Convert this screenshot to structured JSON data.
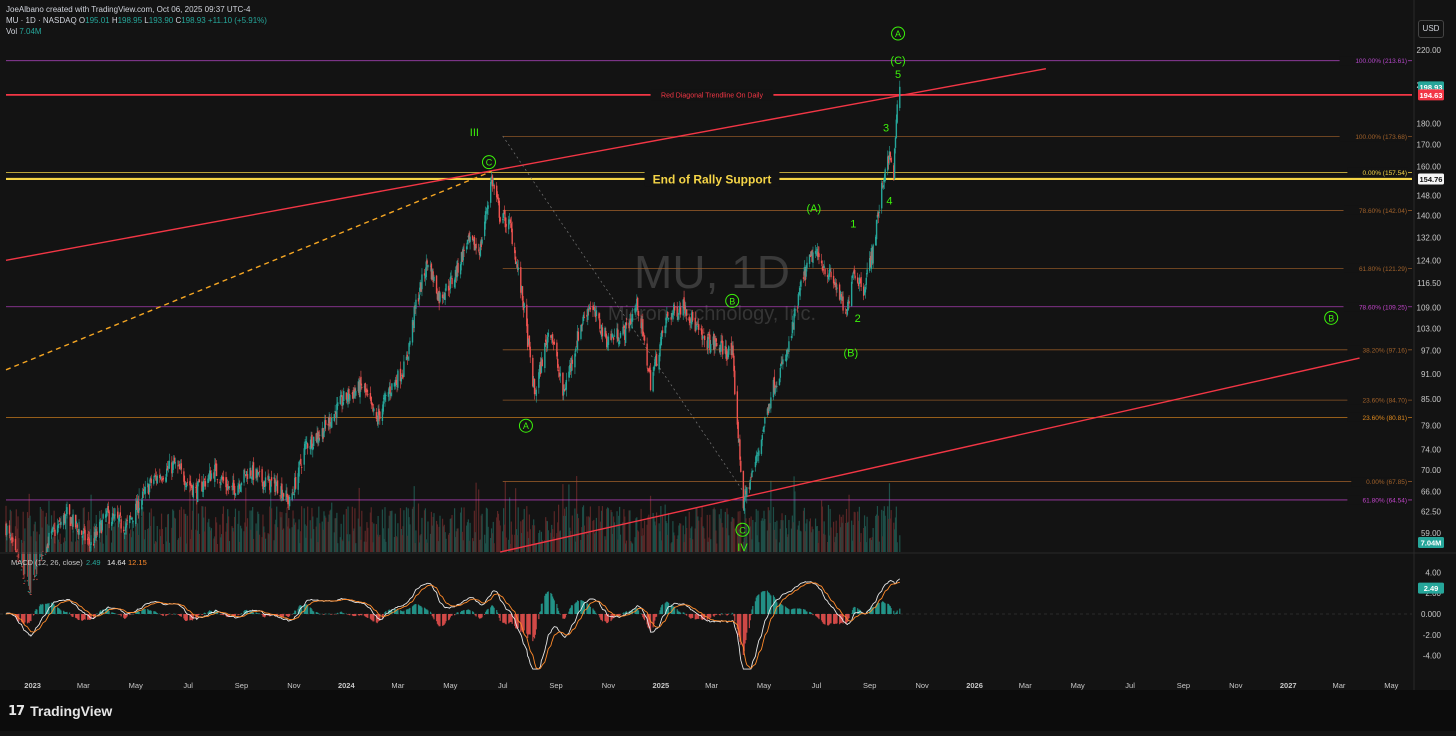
{
  "header": {
    "attribution": "JoeAlbano created with TradingView.com, Oct 06, 2025 09:37 UTC-4",
    "symbol_line": "MU · 1D · NASDAQ",
    "ohlc": [
      {
        "label": "O",
        "value": "195.01"
      },
      {
        "label": "H",
        "value": "198.95"
      },
      {
        "label": "L",
        "value": "193.90"
      },
      {
        "label": "C",
        "value": "198.93"
      },
      {
        "label": "",
        "value": "+11.10 (+5.91%)"
      }
    ],
    "vol_label": "Vol",
    "vol_value": "7.04M",
    "currency": "USD"
  },
  "watermark": {
    "symbol": "MU, 1D",
    "company": "Micron Technology, Inc."
  },
  "footer": {
    "logo_text": "TradingView",
    "logo_mark": "17"
  },
  "colors": {
    "background": "#131313",
    "up": "#26a69a",
    "down": "#ef5350",
    "wave_label": "#3cf20b",
    "trendline": "#f23645",
    "support": "#f5d547",
    "fib_orange": "#d98c26",
    "fib_purple": "#c044c9",
    "macd_line": "#e6e6e6",
    "signal_line": "#ff8a2a"
  },
  "chart_data": [
    {
      "type": "candlestick",
      "title": "MU, 1D",
      "price_scale": "log",
      "ylim": [
        56,
        226
      ],
      "x_range": [
        "2022-12-01",
        "2027-06-01"
      ],
      "y_tick_labels": [
        "220.00",
        "200.00",
        "180.00",
        "170.00",
        "160.00",
        "148.00",
        "140.00",
        "132.00",
        "124.00",
        "116.50",
        "109.00",
        "103.00",
        "97.00",
        "91.00",
        "85.00",
        "79.00",
        "74.00",
        "70.00",
        "66.00",
        "62.50",
        "59.00"
      ],
      "x_tick_labels": [
        {
          "label": "2023",
          "date": "2023-01-01",
          "bold": true
        },
        {
          "label": "Mar",
          "date": "2023-03-01"
        },
        {
          "label": "May",
          "date": "2023-05-01"
        },
        {
          "label": "Jul",
          "date": "2023-07-01"
        },
        {
          "label": "Sep",
          "date": "2023-09-01"
        },
        {
          "label": "Nov",
          "date": "2023-11-01"
        },
        {
          "label": "2024",
          "date": "2024-01-01",
          "bold": true
        },
        {
          "label": "Mar",
          "date": "2024-03-01"
        },
        {
          "label": "May",
          "date": "2024-05-01"
        },
        {
          "label": "Jul",
          "date": "2024-07-01"
        },
        {
          "label": "Sep",
          "date": "2024-09-01"
        },
        {
          "label": "Nov",
          "date": "2024-11-01"
        },
        {
          "label": "2025",
          "date": "2025-01-01",
          "bold": true
        },
        {
          "label": "Mar",
          "date": "2025-03-01"
        },
        {
          "label": "May",
          "date": "2025-05-01"
        },
        {
          "label": "Jul",
          "date": "2025-07-01"
        },
        {
          "label": "Sep",
          "date": "2025-09-01"
        },
        {
          "label": "Nov",
          "date": "2025-11-01"
        },
        {
          "label": "2026",
          "date": "2026-01-01",
          "bold": true
        },
        {
          "label": "Mar",
          "date": "2026-03-01"
        },
        {
          "label": "May",
          "date": "2026-05-01"
        },
        {
          "label": "Jul",
          "date": "2026-07-01"
        },
        {
          "label": "Sep",
          "date": "2026-09-01"
        },
        {
          "label": "Nov",
          "date": "2026-11-01"
        },
        {
          "label": "2027",
          "date": "2027-01-01",
          "bold": true
        },
        {
          "label": "Mar",
          "date": "2027-03-01"
        },
        {
          "label": "May",
          "date": "2027-05-01"
        }
      ],
      "price_path": [
        {
          "date": "2022-12-01",
          "close": 60
        },
        {
          "date": "2022-12-28",
          "close": 49
        },
        {
          "date": "2023-01-20",
          "close": 58
        },
        {
          "date": "2023-02-10",
          "close": 62
        },
        {
          "date": "2023-03-10",
          "close": 57
        },
        {
          "date": "2023-03-28",
          "close": 62
        },
        {
          "date": "2023-04-20",
          "close": 60
        },
        {
          "date": "2023-05-20",
          "close": 68
        },
        {
          "date": "2023-06-15",
          "close": 71
        },
        {
          "date": "2023-07-10",
          "close": 66
        },
        {
          "date": "2023-08-01",
          "close": 70
        },
        {
          "date": "2023-08-20",
          "close": 66
        },
        {
          "date": "2023-09-10",
          "close": 70
        },
        {
          "date": "2023-09-25",
          "close": 68
        },
        {
          "date": "2023-10-15",
          "close": 67
        },
        {
          "date": "2023-10-27",
          "close": 64
        },
        {
          "date": "2023-11-15",
          "close": 75
        },
        {
          "date": "2023-12-05",
          "close": 78
        },
        {
          "date": "2023-12-29",
          "close": 85
        },
        {
          "date": "2024-01-20",
          "close": 88
        },
        {
          "date": "2024-02-05",
          "close": 80
        },
        {
          "date": "2024-02-20",
          "close": 87
        },
        {
          "date": "2024-03-10",
          "close": 93
        },
        {
          "date": "2024-03-22",
          "close": 110
        },
        {
          "date": "2024-04-05",
          "close": 124
        },
        {
          "date": "2024-04-18",
          "close": 112
        },
        {
          "date": "2024-05-05",
          "close": 118
        },
        {
          "date": "2024-05-20",
          "close": 130
        },
        {
          "date": "2024-06-05",
          "close": 128
        },
        {
          "date": "2024-06-18",
          "close": 155
        },
        {
          "date": "2024-06-28",
          "close": 140
        },
        {
          "date": "2024-07-10",
          "close": 136
        },
        {
          "date": "2024-07-25",
          "close": 110
        },
        {
          "date": "2024-08-07",
          "close": 86
        },
        {
          "date": "2024-08-25",
          "close": 104
        },
        {
          "date": "2024-09-09",
          "close": 86
        },
        {
          "date": "2024-09-30",
          "close": 104
        },
        {
          "date": "2024-10-10",
          "close": 110
        },
        {
          "date": "2024-10-30",
          "close": 100
        },
        {
          "date": "2024-11-20",
          "close": 102
        },
        {
          "date": "2024-12-05",
          "close": 110
        },
        {
          "date": "2024-12-20",
          "close": 89
        },
        {
          "date": "2025-01-08",
          "close": 106
        },
        {
          "date": "2025-01-28",
          "close": 110
        },
        {
          "date": "2025-02-18",
          "close": 100
        },
        {
          "date": "2025-03-10",
          "close": 98
        },
        {
          "date": "2025-03-25",
          "close": 96
        },
        {
          "date": "2025-04-07",
          "close": 64
        },
        {
          "date": "2025-04-22",
          "close": 72
        },
        {
          "date": "2025-05-10",
          "close": 87
        },
        {
          "date": "2025-05-28",
          "close": 96
        },
        {
          "date": "2025-06-15",
          "close": 118
        },
        {
          "date": "2025-06-28",
          "close": 127
        },
        {
          "date": "2025-07-10",
          "close": 122
        },
        {
          "date": "2025-07-25",
          "close": 115
        },
        {
          "date": "2025-08-05",
          "close": 106
        },
        {
          "date": "2025-08-12",
          "close": 121
        },
        {
          "date": "2025-08-25",
          "close": 115
        },
        {
          "date": "2025-09-05",
          "close": 128
        },
        {
          "date": "2025-09-15",
          "close": 150
        },
        {
          "date": "2025-09-22",
          "close": 166
        },
        {
          "date": "2025-09-29",
          "close": 158
        },
        {
          "date": "2025-10-03",
          "close": 188
        },
        {
          "date": "2025-10-06",
          "close": 198.93
        }
      ],
      "price_markers": [
        {
          "value": 198.93,
          "label": "198.93",
          "color": "#26a69a"
        },
        {
          "value": 194.63,
          "label": "194.63",
          "color": "#f23645"
        },
        {
          "value": 154.76,
          "label": "154.76",
          "color": "#f5f5f5",
          "text_color": "#111111"
        }
      ],
      "volume_marker": {
        "label": "7.04M",
        "color": "#26a69a"
      },
      "horizontal_levels": [
        {
          "value": 213.61,
          "label": "100.00% (213.61)",
          "color": "#b447c9",
          "start": "2022-12-01"
        },
        {
          "value": 194.63,
          "label": "Red Diagonal Trendline On Daily",
          "color": "#f23645",
          "start": "2022-12-01",
          "label_position": "center",
          "width": 1.8
        },
        {
          "value": 173.68,
          "label": "100.00% (173.68)",
          "color": "#a0612a",
          "start": "2024-07-01"
        },
        {
          "value": 157.54,
          "label": "0.00% (157.54)",
          "color": "#f5d547",
          "start": "2022-12-01"
        },
        {
          "value": 154.76,
          "label": "End of Rally Support",
          "color": "#f5d547",
          "start": "2022-12-01",
          "label_position": "center",
          "bold": true,
          "width": 2.2
        },
        {
          "value": 142.04,
          "label": "78.60% (142.04)",
          "color": "#a0612a",
          "start": "2024-07-01"
        },
        {
          "value": 121.29,
          "label": "61.80% (121.29)",
          "color": "#a0612a",
          "start": "2024-07-01"
        },
        {
          "value": 109.25,
          "label": "78.60% (109.25)",
          "color": "#c044c9",
          "start": "2022-12-01"
        },
        {
          "value": 97.16,
          "label": "38.20% (97.16)",
          "color": "#a0612a",
          "start": "2024-07-01"
        },
        {
          "value": 84.7,
          "label": "23.60% (84.70)",
          "color": "#a0612a",
          "start": "2024-07-01"
        },
        {
          "value": 80.81,
          "label": "23.60% (80.81)",
          "color": "#e08a1e",
          "start": "2022-12-01"
        },
        {
          "value": 67.85,
          "label": "0.00% (67.85)",
          "color": "#a0612a",
          "start": "2024-07-01"
        },
        {
          "value": 64.54,
          "label": "61.80% (64.54)",
          "color": "#c044c9",
          "start": "2022-12-01"
        }
      ],
      "trendlines": [
        {
          "name": "upper-red-trendline",
          "color": "#f23645",
          "from": {
            "date": "2022-12-01",
            "value": 124
          },
          "to": {
            "date": "2026-03-25",
            "value": 209
          }
        },
        {
          "name": "lower-red-trendline",
          "color": "#f23645",
          "from": {
            "date": "2024-06-28",
            "value": 56
          },
          "to": {
            "date": "2027-03-25",
            "value": 95
          }
        },
        {
          "name": "orange-dashed-trendline",
          "color": "#f5a623",
          "dash": true,
          "from": {
            "date": "2022-12-01",
            "value": 92
          },
          "to": {
            "date": "2024-06-18",
            "value": 158
          }
        },
        {
          "name": "grey-dotted-trendline",
          "color": "#777777",
          "dash": "dot",
          "from": {
            "date": "2024-07-01",
            "value": 174
          },
          "to": {
            "date": "2025-04-07",
            "value": 66
          }
        }
      ],
      "wave_labels": [
        {
          "text": "A",
          "circled": true,
          "date": "2025-10-04",
          "value": 230
        },
        {
          "text": "(C)",
          "date": "2025-10-04",
          "value": 214
        },
        {
          "text": "5",
          "date": "2025-10-04",
          "value": 206
        },
        {
          "text": "3",
          "date": "2025-09-20",
          "value": 178
        },
        {
          "text": "4",
          "date": "2025-09-24",
          "value": 146
        },
        {
          "text": "1",
          "date": "2025-08-13",
          "value": 137
        },
        {
          "text": "2",
          "date": "2025-08-18",
          "value": 106
        },
        {
          "text": "(A)",
          "date": "2025-06-28",
          "value": 143
        },
        {
          "text": "(B)",
          "date": "2025-08-10",
          "value": 96.5
        },
        {
          "text": "III",
          "date": "2024-05-29",
          "value": 176
        },
        {
          "text": "C",
          "circled": true,
          "date": "2024-06-15",
          "value": 162
        },
        {
          "text": "B",
          "circled": true,
          "date": "2025-03-25",
          "value": 111
        },
        {
          "text": "A",
          "circled": true,
          "date": "2024-07-28",
          "value": 79
        },
        {
          "text": "C",
          "circled": true,
          "date": "2025-04-06",
          "value": 59.5
        },
        {
          "text": "IV",
          "date": "2025-04-06",
          "value": 56.8
        },
        {
          "text": "B",
          "circled": true,
          "date": "2027-02-20",
          "value": 106
        }
      ]
    },
    {
      "type": "line",
      "title": "MACD (12, 26, close)",
      "header_values": [
        "2.49",
        "14.64",
        "12.15"
      ],
      "ylim": [
        -5,
        5
      ],
      "y_tick_labels": [
        "4.00",
        "2.00",
        "0.000",
        "-2.00",
        "-4.00"
      ],
      "current_marker": {
        "value": 2.49,
        "label": "2.49"
      },
      "series": [
        {
          "name": "MACD",
          "color": "#e6e6e6"
        },
        {
          "name": "Signal",
          "color": "#ff8a2a"
        },
        {
          "name": "Histogram",
          "up_color": "#26a69a",
          "down_color": "#ef5350"
        }
      ]
    }
  ]
}
